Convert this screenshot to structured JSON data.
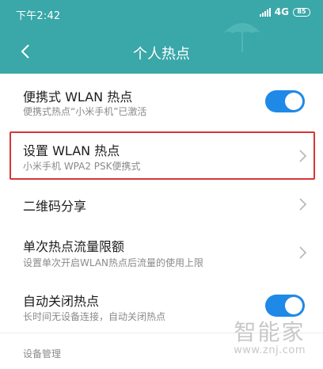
{
  "status_bar": {
    "time": "下午2:42",
    "network": "4G",
    "battery": "85"
  },
  "header": {
    "title": "个人热点",
    "color": "#3aa7a8"
  },
  "settings": [
    {
      "title": "便携式 WLAN 热点",
      "subtitle": "便携式热点“小米手机”已激活",
      "control": "toggle",
      "on": true
    },
    {
      "title": "设置 WLAN 热点",
      "subtitle": "小米手机 WPA2 PSK便携式",
      "control": "chevron",
      "highlighted": true
    },
    {
      "title": "二维码分享",
      "control": "chevron"
    },
    {
      "title": "单次热点流量限额",
      "subtitle": "设置单次开启WLAN热点后流量的使用上限",
      "control": "chevron"
    },
    {
      "title": "自动关闭热点",
      "subtitle": "长时间无设备连接，自动关闭热点",
      "control": "toggle",
      "on": true
    }
  ],
  "section_label": "设备管理",
  "watermark": {
    "text": "智能家",
    "url": "www.znj.com"
  },
  "colors": {
    "toggle_on": "#1f89e8",
    "highlight_border": "#d53636"
  }
}
